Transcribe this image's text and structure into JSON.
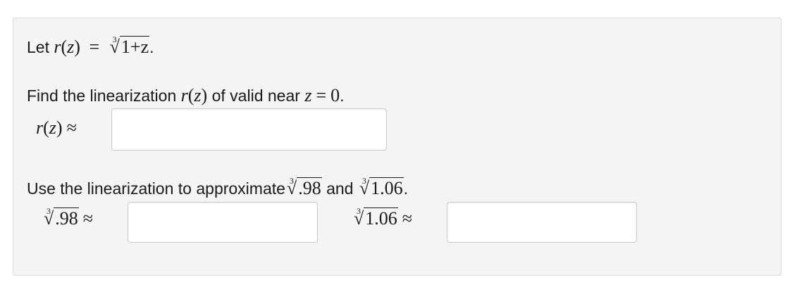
{
  "intro": {
    "prefix": "Let",
    "func": "r",
    "var": "z",
    "eq": "=",
    "root_index": "3",
    "radicand": "1+z",
    "suffix": "."
  },
  "task1": {
    "text": "Find the linearization",
    "func": "r",
    "var": "z",
    "middle": "of valid near",
    "cond_var": "z",
    "eq": "=",
    "cond_val": "0",
    "suffix": "."
  },
  "field1": {
    "func": "r",
    "var": "z",
    "approx": "≈",
    "value": ""
  },
  "task2": {
    "text": "Use the linearization to approximate",
    "root_index": "3",
    "a": ".98",
    "conj": "and",
    "b": "1.06",
    "suffix": "."
  },
  "field2": {
    "root_index": "3",
    "radicand": ".98",
    "approx": "≈",
    "value": ""
  },
  "field3": {
    "root_index": "3",
    "radicand": "1.06",
    "approx": "≈",
    "value": ""
  }
}
